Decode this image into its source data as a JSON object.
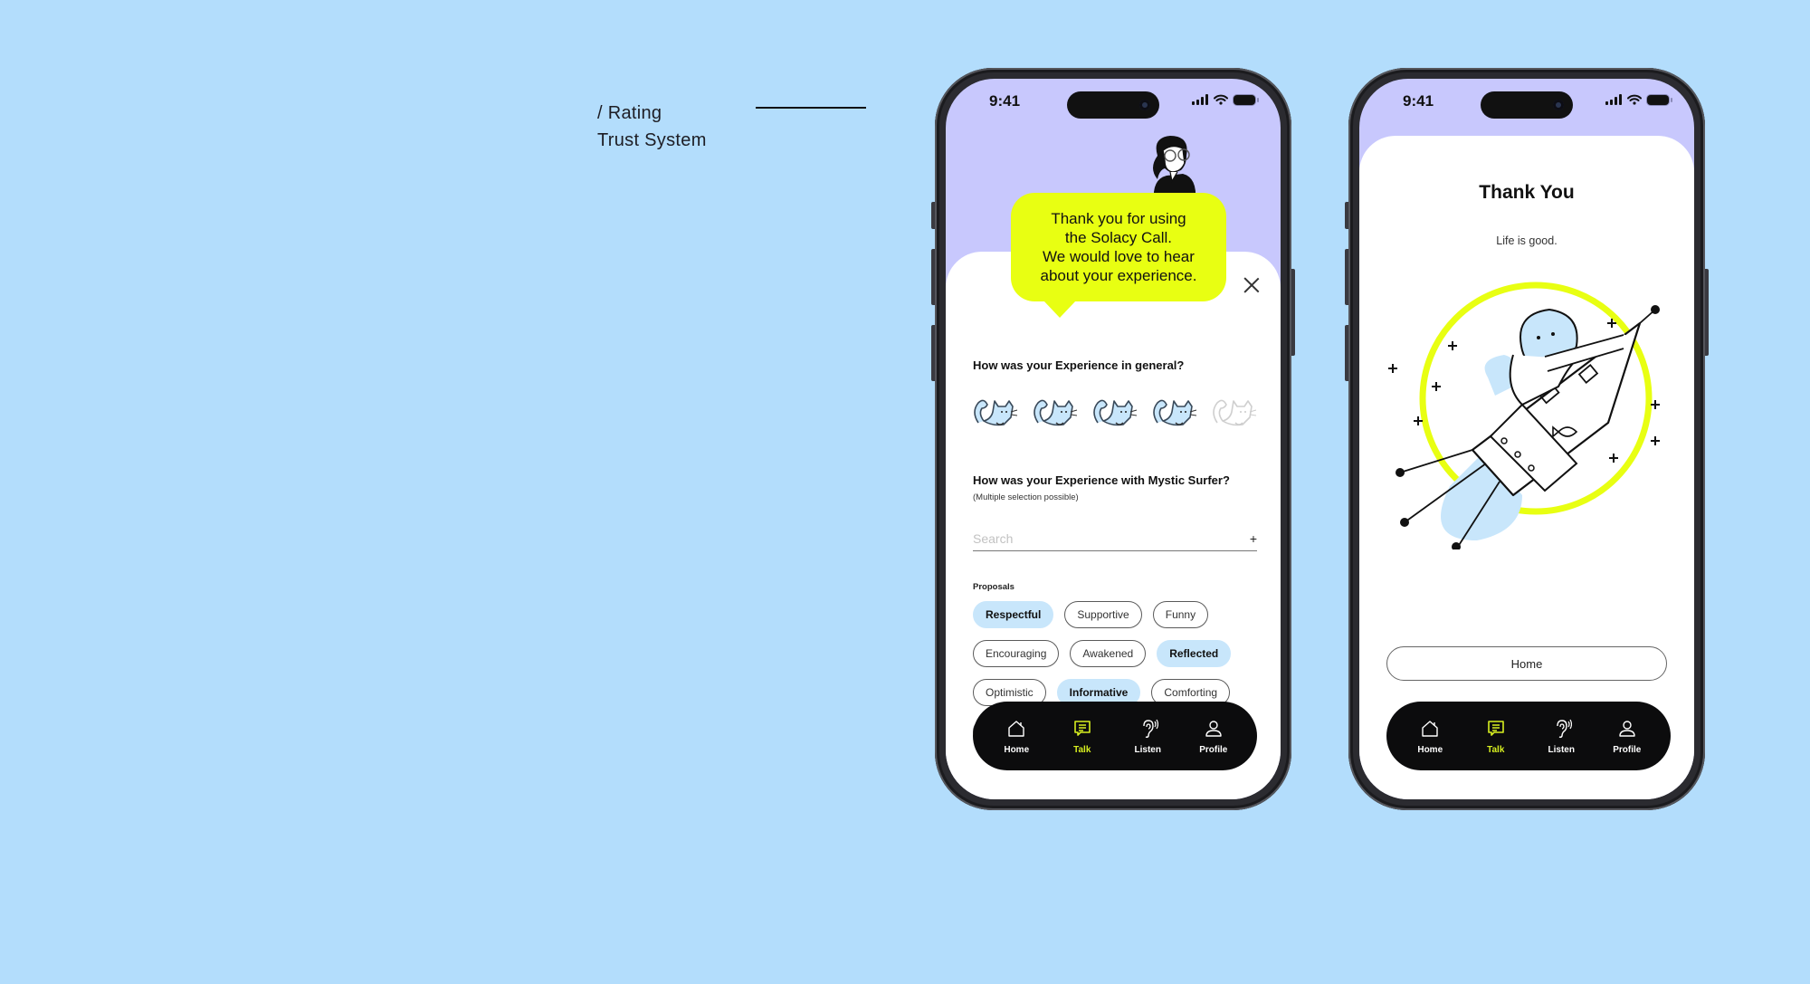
{
  "caption": {
    "line1": "/ Rating",
    "line2": "Trust System"
  },
  "colors": {
    "background": "#b3ddfc",
    "header": "#c8c8fd",
    "accent": "#e8ff12",
    "chip_selected": "#c8e6fb",
    "nav_active": "#d8f020"
  },
  "phones": [
    {
      "status": {
        "time": "9:41"
      },
      "bubble": {
        "lines": [
          "Thank you for using",
          "the Solacy Call.",
          "We would love to hear",
          "about your experience."
        ]
      },
      "close_icon": "close-icon",
      "question1": "How was your Experience in general?",
      "rating": {
        "value": 4,
        "max": 5,
        "icon": "cat-icon"
      },
      "question2": "How was your Experience with Mystic Surfer?",
      "question2_hint": "(Multiple selection possible)",
      "search": {
        "value": "",
        "placeholder": "Search",
        "add_label": "+"
      },
      "proposals_label": "Proposals",
      "chips": [
        {
          "label": "Respectful",
          "selected": true
        },
        {
          "label": "Supportive",
          "selected": false
        },
        {
          "label": "Funny",
          "selected": false
        },
        {
          "label": "Encouraging",
          "selected": false
        },
        {
          "label": "Awakened",
          "selected": false
        },
        {
          "label": "Reflected",
          "selected": true
        },
        {
          "label": "Optimistic",
          "selected": false
        },
        {
          "label": "Informative",
          "selected": true
        },
        {
          "label": "Comforting",
          "selected": false
        },
        {
          "label": "",
          "selected": false
        },
        {
          "label": "",
          "selected": false
        },
        {
          "label": "",
          "selected": false
        }
      ]
    },
    {
      "status": {
        "time": "9:41"
      },
      "title": "Thank You",
      "subtitle": "Life is good.",
      "home_button": "Home"
    }
  ],
  "nav": [
    {
      "label": "Home",
      "icon": "home-icon",
      "active": false
    },
    {
      "label": "Talk",
      "icon": "chat-icon",
      "active": true
    },
    {
      "label": "Listen",
      "icon": "ear-icon",
      "active": false
    },
    {
      "label": "Profile",
      "icon": "user-icon",
      "active": false
    }
  ]
}
